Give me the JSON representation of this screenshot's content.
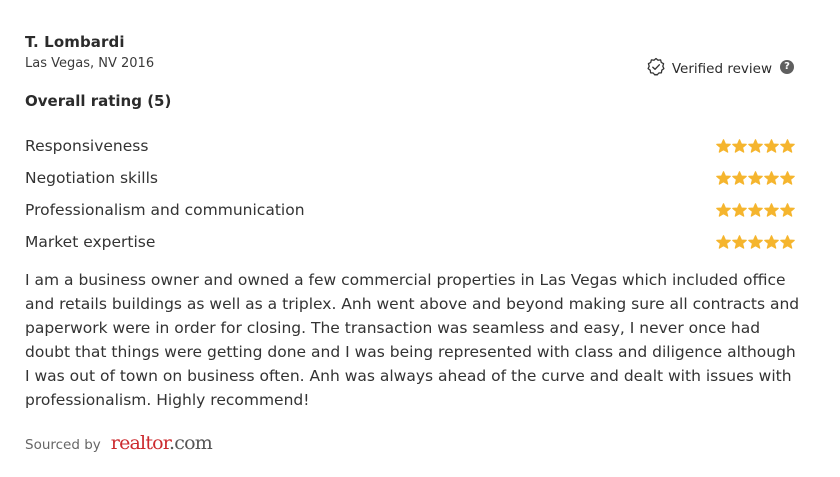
{
  "reviewer": {
    "name": "T. Lombardi",
    "meta": "Las Vegas, NV 2016"
  },
  "verified": {
    "label": "Verified review",
    "icon": "verified-badge-icon",
    "help_icon": "question-circle-icon",
    "help_glyph": "?"
  },
  "overall": {
    "label": "Overall rating (5)",
    "value": 5
  },
  "ratings": [
    {
      "label": "Responsiveness",
      "stars": 5
    },
    {
      "label": "Negotiation skills",
      "stars": 5
    },
    {
      "label": "Professionalism and communication",
      "stars": 5
    },
    {
      "label": "Market expertise",
      "stars": 5
    }
  ],
  "colors": {
    "star": "#F5B52E",
    "brand": "#CC2A2E"
  },
  "review": {
    "text": "I am a business owner and owned a few commercial properties in Las Vegas which included office and retails buildings as well as a triplex. Anh went above and beyond making sure all contracts and paperwork were in order for closing. The transaction was seamless and easy, I never once had doubt that things were getting done and I was being represented with class and diligence although I was out of town on business often. Anh was always ahead of the curve and dealt with issues with professionalism. Highly recommend!"
  },
  "source": {
    "label": "Sourced by",
    "logo_main": "realtor",
    "logo_suffix": ".com"
  }
}
